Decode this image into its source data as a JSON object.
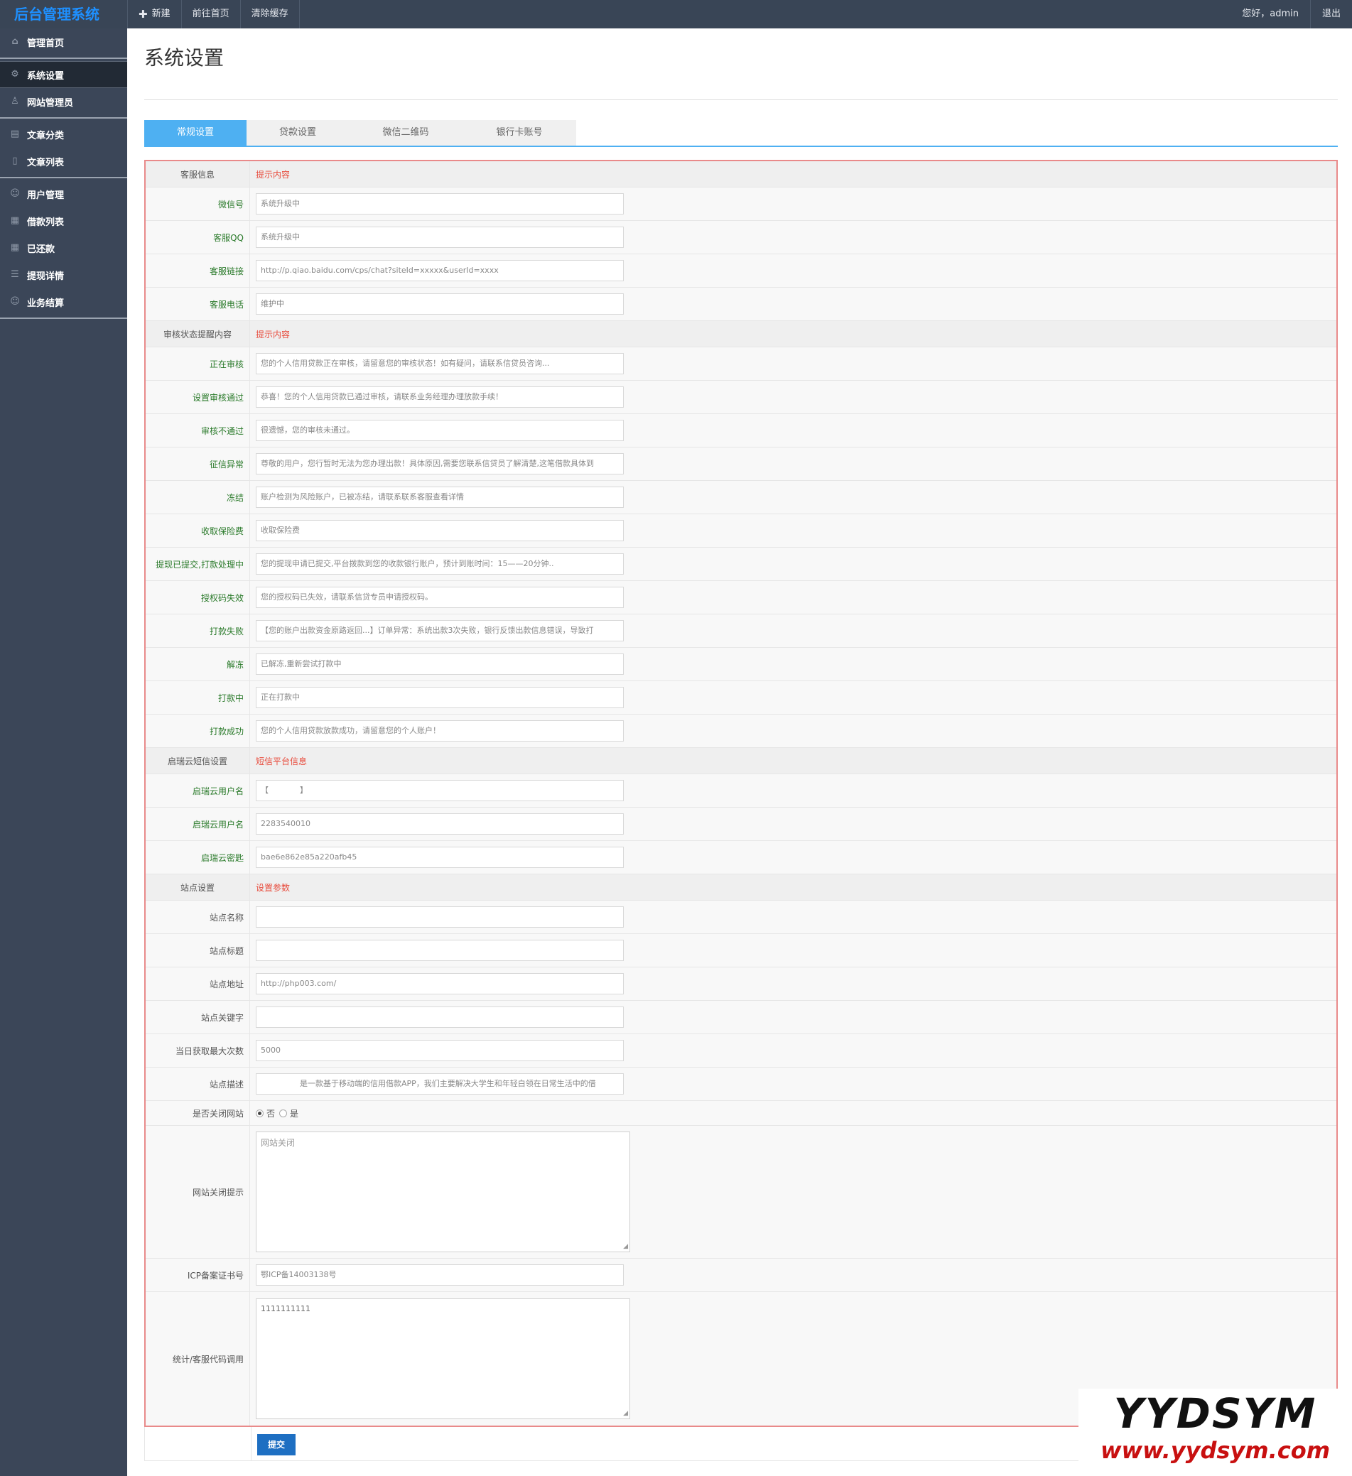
{
  "app": {
    "brand": "后台管理系统"
  },
  "topnav": {
    "new_label": "新建",
    "home_label": "前往首页",
    "clear_cache_label": "清除缓存"
  },
  "topright": {
    "greeting": "您好，admin",
    "logout": "退出"
  },
  "sidebar": {
    "items": [
      {
        "label": "管理首页",
        "icon": "home-icon"
      },
      {
        "label": "系统设置",
        "icon": "gear-icon"
      },
      {
        "label": "网站管理员",
        "icon": "user-icon"
      },
      {
        "label": "文章分类",
        "icon": "book-icon"
      },
      {
        "label": "文章列表",
        "icon": "document-icon"
      },
      {
        "label": "用户管理",
        "icon": "users-icon"
      },
      {
        "label": "借款列表",
        "icon": "grid-icon"
      },
      {
        "label": "已还款",
        "icon": "grid-icon"
      },
      {
        "label": "提现详情",
        "icon": "list-icon"
      },
      {
        "label": "业务结算",
        "icon": "users-icon"
      }
    ]
  },
  "page": {
    "title": "系统设置"
  },
  "tabs": [
    "常规设置",
    "贷款设置",
    "微信二维码",
    "银行卡账号"
  ],
  "sections": {
    "kefu": {
      "label": "客服信息",
      "hint": "提示内容"
    },
    "audit": {
      "label": "审核状态提醒内容",
      "hint": "提示内容"
    },
    "sms": {
      "label": "启瑞云短信设置",
      "hint": "短信平台信息"
    },
    "site": {
      "label": "站点设置",
      "hint": "设置参数"
    }
  },
  "fields": {
    "wechat": {
      "label": "微信号",
      "value": "系统升级中"
    },
    "qq": {
      "label": "客服QQ",
      "value": "系统升级中"
    },
    "link": {
      "label": "客服链接",
      "value": "http://p.qiao.baidu.com/cps/chat?siteId=xxxxx&userId=xxxx"
    },
    "phone": {
      "label": "客服电话",
      "value": "维护中"
    },
    "reviewing": {
      "label": "正在审核",
      "value": "您的个人信用贷款正在审核，请留意您的审核状态！如有疑问，请联系信贷员咨询..."
    },
    "approved": {
      "label": "设置审核通过",
      "value": "恭喜！您的个人信用贷款已通过审核，请联系业务经理办理放款手续！"
    },
    "rejected": {
      "label": "审核不通过",
      "value": "很遗憾，您的审核未通过。"
    },
    "credit_abnormal": {
      "label": "征信异常",
      "value": "尊敬的用户，您行暂时无法为您办理出款！具体原因,需要您联系信贷员了解清楚,这笔借款具体到"
    },
    "frozen": {
      "label": "冻结",
      "value": "账户检测为风险账户，已被冻结，请联系联系客服查看详情"
    },
    "insurance": {
      "label": "收取保险费",
      "value": "收取保险费"
    },
    "withdraw_submitted": {
      "label": "提现已提交,打款处理中",
      "value": "您的提现申请已提交,平台拨款到您的收款银行账户，预计到账时间：15——20分钟.."
    },
    "auth_invalid": {
      "label": "授权码失效",
      "value": "您的授权码已失效，请联系信贷专员申请授权码。"
    },
    "pay_failed": {
      "label": "打款失败",
      "value": "【您的账户出款资金原路返回...】订单异常：系统出款3次失败，银行反馈出款信息错误，导致打"
    },
    "unfreeze": {
      "label": "解冻",
      "value": "已解冻,重新尝试打款中"
    },
    "paying": {
      "label": "打款中",
      "value": "正在打款中"
    },
    "pay_success": {
      "label": "打款成功",
      "value": "您的个人信用贷款放款成功，请留意您的个人账户！"
    },
    "sms_user": {
      "label": "启瑞云用户名",
      "value": "【　　　　】"
    },
    "sms_user2": {
      "label": "启瑞云用户名",
      "value": "2283540010"
    },
    "sms_key": {
      "label": "启瑞云密匙",
      "value": "bae6e862e85a220afb45"
    },
    "site_name": {
      "label": "站点名称",
      "value": ""
    },
    "site_title": {
      "label": "站点标题",
      "value": ""
    },
    "site_url": {
      "label": "站点地址",
      "value": "http://php003.com/"
    },
    "site_keywords": {
      "label": "站点关键字",
      "value": ""
    },
    "daily_max": {
      "label": "当日获取最大次数",
      "value": "5000"
    },
    "site_desc": {
      "label": "站点描述",
      "value": "　　　　　是一款基于移动端的信用借款APP，我们主要解决大学生和年轻白领在日常生活中的借"
    },
    "close_site": {
      "label": "是否关闭网站",
      "opt_no": "否",
      "opt_yes": "是"
    },
    "close_tip": {
      "label": "网站关闭提示",
      "placeholder": "网站关闭"
    },
    "icp": {
      "label": "ICP备案证书号",
      "value": "鄂ICP备14003138号"
    },
    "stats_code": {
      "label": "统计/客服代码调用",
      "value": "1111111111"
    }
  },
  "submit": {
    "label": "提交"
  },
  "watermark": {
    "big": "YYDSYM",
    "small": "www.yydsym.com"
  },
  "colors": {
    "accent": "#4eb0f2",
    "topbar": "#394556",
    "sidebar": "#3b4658",
    "hint": "#e84c3d",
    "submit": "#1e6fc2"
  }
}
